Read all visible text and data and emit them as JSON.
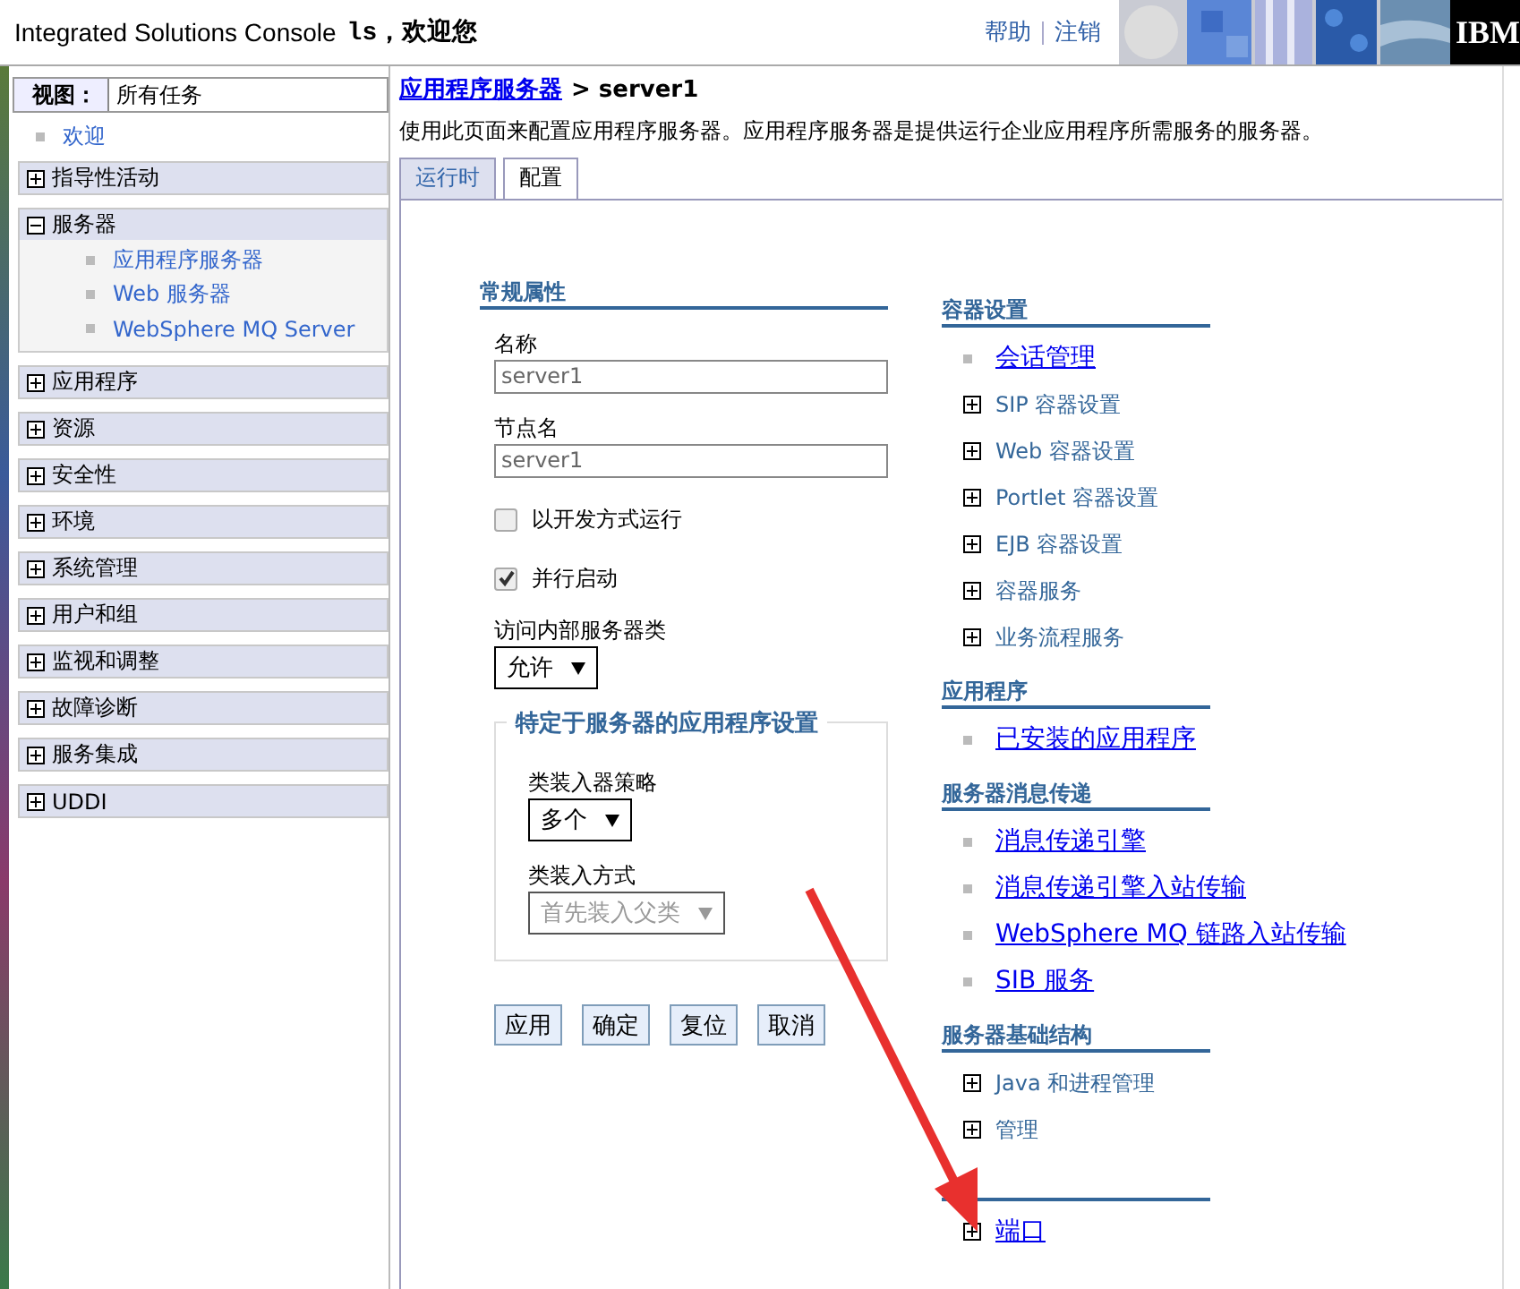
{
  "header": {
    "title": "Integrated Solutions Console",
    "greeting": "ls，欢迎您",
    "links": [
      "帮助",
      "注销"
    ],
    "logo": "IBM"
  },
  "sidebar": {
    "view_label": "视图：",
    "view_value": "所有任务",
    "welcome": "欢迎",
    "groups": [
      {
        "label": "指导性活动",
        "expanded": false
      },
      {
        "label": "服务器",
        "expanded": true,
        "children": [
          "应用程序服务器",
          "Web 服务器",
          "WebSphere MQ Server"
        ]
      },
      {
        "label": "应用程序",
        "expanded": false
      },
      {
        "label": "资源",
        "expanded": false
      },
      {
        "label": "安全性",
        "expanded": false
      },
      {
        "label": "环境",
        "expanded": false
      },
      {
        "label": "系统管理",
        "expanded": false
      },
      {
        "label": "用户和组",
        "expanded": false
      },
      {
        "label": "监视和调整",
        "expanded": false
      },
      {
        "label": "故障诊断",
        "expanded": false
      },
      {
        "label": "服务集成",
        "expanded": false
      },
      {
        "label": "UDDI",
        "expanded": false
      }
    ]
  },
  "main": {
    "breadcrumb_link": "应用程序服务器",
    "breadcrumb_current": "> server1",
    "description": "使用此页面来配置应用程序服务器。应用程序服务器是提供运行企业应用程序所需服务的服务器。",
    "tabs": [
      {
        "label": "运行时",
        "selected": false
      },
      {
        "label": "配置",
        "selected": true
      }
    ],
    "general": {
      "heading": "常规属性",
      "fields": [
        {
          "label": "名称",
          "value": "server1"
        },
        {
          "label": "节点名",
          "value": "server1"
        }
      ],
      "checkboxes": [
        {
          "label": "以开发方式运行",
          "checked": false
        },
        {
          "label": "并行启动",
          "checked": true
        }
      ],
      "select_label": "访问内部服务器类",
      "select_value": "允许",
      "fieldset": {
        "legend": "特定于服务器的应用程序设置",
        "selects": [
          {
            "label": "类装入器策略",
            "value": "多个",
            "disabled": false
          },
          {
            "label": "类装入方式",
            "value": "首先装入父类",
            "disabled": true
          }
        ]
      },
      "buttons": [
        "应用",
        "确定",
        "复位",
        "取消"
      ]
    },
    "sections": [
      {
        "heading": "容器设置",
        "items": [
          {
            "kind": "link",
            "label": "会话管理"
          },
          {
            "kind": "expand",
            "label": "SIP 容器设置"
          },
          {
            "kind": "expand",
            "label": "Web 容器设置"
          },
          {
            "kind": "expand",
            "label": "Portlet 容器设置"
          },
          {
            "kind": "expand",
            "label": "EJB 容器设置"
          },
          {
            "kind": "expand",
            "label": "容器服务"
          },
          {
            "kind": "expand",
            "label": "业务流程服务"
          }
        ]
      },
      {
        "heading": "应用程序",
        "items": [
          {
            "kind": "link",
            "label": "已安装的应用程序"
          }
        ]
      },
      {
        "heading": "服务器消息传递",
        "items": [
          {
            "kind": "link",
            "label": "消息传递引擎"
          },
          {
            "kind": "link",
            "label": "消息传递引擎入站传输"
          },
          {
            "kind": "link",
            "label": "WebSphere MQ 链路入站传输"
          },
          {
            "kind": "link",
            "label": "SIB 服务"
          }
        ]
      },
      {
        "heading": "服务器基础结构",
        "items": [
          {
            "kind": "expand",
            "label": "Java 和进程管理"
          },
          {
            "kind": "expand",
            "label": "管理"
          }
        ]
      },
      {
        "items": [
          {
            "kind": "expand_link",
            "label": "端口"
          }
        ]
      }
    ]
  }
}
